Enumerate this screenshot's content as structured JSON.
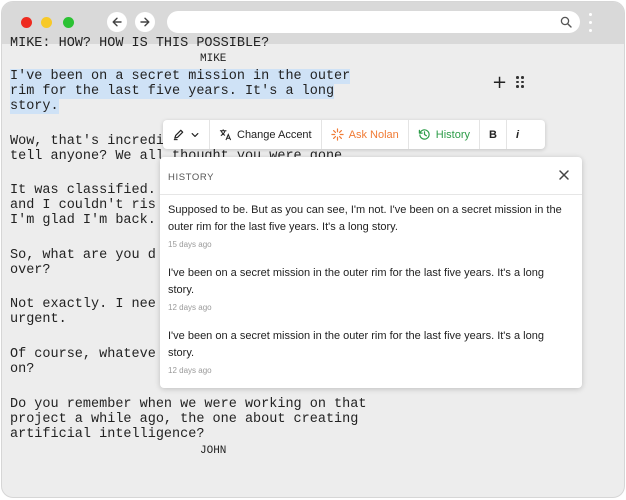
{
  "browser": {
    "colors": {
      "close": "#ee2a1f",
      "minimize": "#f7c928",
      "maximize": "#2bc233"
    },
    "icons": [
      "back-arrow-icon",
      "forward-arrow-icon",
      "search-icon",
      "kebab-menu-icon"
    ]
  },
  "script": {
    "top_partial": "MIKE: HOW? HOW IS THIS POSSIBLE?",
    "char_mike": "MIKE",
    "hl1": "I've been on a secret mission in the outer",
    "hl2": "rim for the last five years. It's a long",
    "hl3": "story.",
    "l_wow1": "Wow, that's incredi",
    "l_wow2": "tell anyone? We all thought you were gone",
    "l_class1": "It was classified.",
    "l_class2": "and I couldn't ris",
    "l_class3": "I'm glad I'm back.",
    "l_sowhat1": "So, what are you d",
    "l_sowhat2": "over?",
    "l_notex1": "Not exactly. I nee",
    "l_notex2": "urgent.",
    "l_course1": "Of course, whateve",
    "l_course2": "on?",
    "l_remember1": "Do you remember when we were working on that",
    "l_remember2": "project a while ago, the one about creating",
    "l_remember3": "artificial intelligence?",
    "char_john": "JOHN"
  },
  "toolbar": {
    "change_accent": "Change Accent",
    "ask_nolan": "Ask Nolan",
    "history": "History",
    "bold": "B",
    "italic": "i",
    "accent_color": "#f07b35",
    "history_color": "#2c9c48"
  },
  "history_panel": {
    "title": "HISTORY",
    "entries": [
      {
        "text": "Supposed to be. But as you can see, I'm not. I've been on a secret mission in the outer rim for the last five years. It's a long story.",
        "time": "15 days ago"
      },
      {
        "text": " I've been on a secret mission in the outer rim for the last five years. It's a long story.",
        "time": "12 days ago"
      },
      {
        "text": "I've been on a secret mission in the outer rim for the last five years. It's a long story.",
        "time": "12 days ago"
      }
    ]
  }
}
